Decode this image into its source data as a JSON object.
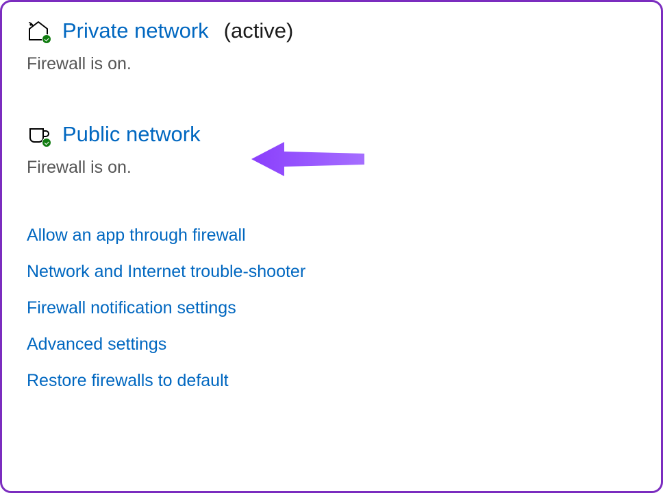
{
  "private": {
    "title": "Private network",
    "active": "(active)",
    "status": "Firewall is on."
  },
  "public": {
    "title": "Public network",
    "status": "Firewall is on."
  },
  "links": {
    "allow_app": "Allow an app through firewall",
    "troubleshooter": "Network and Internet trouble-shooter",
    "notifications": "Firewall notification settings",
    "advanced": "Advanced settings",
    "restore": "Restore firewalls to default"
  },
  "colors": {
    "link": "#0067C0",
    "border": "#7B2CBF",
    "arrow": "#8A3FFC",
    "check": "#107C10"
  }
}
